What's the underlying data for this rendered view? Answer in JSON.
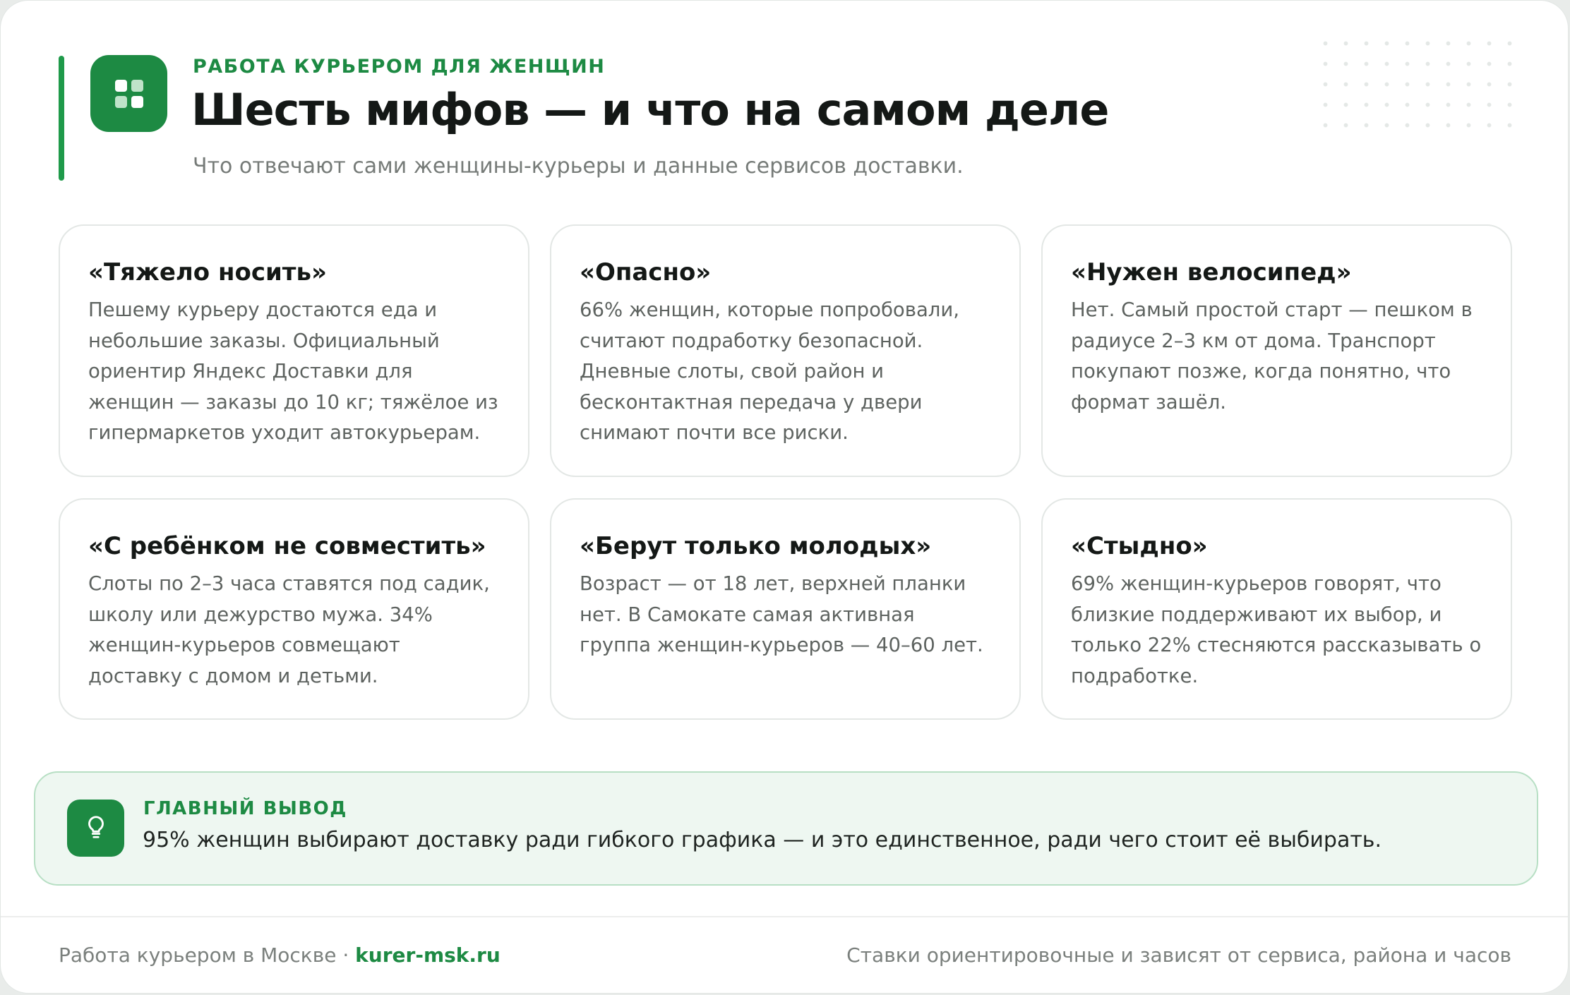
{
  "header": {
    "eyebrow": "РАБОТА КУРЬЕРОМ ДЛЯ ЖЕНЩИН",
    "title": "Шесть мифов — и что на самом деле",
    "subtitle": "Что отвечают сами женщины-курьеры и данные сервисов доставки.",
    "logo_icon": "grid-icon"
  },
  "cards": [
    {
      "title": "«Тяжело носить»",
      "text": "Пешему курьеру достаются еда и небольшие заказы. Официальный ориентир Яндекс Доставки для женщин — заказы до 10 кг; тяжёлое из гипермаркетов уходит автокурьерам."
    },
    {
      "title": "«Опасно»",
      "text": "66% женщин, которые попробовали, считают подработку безопасной. Дневные слоты, свой район и бесконтактная передача у двери снимают почти все риски."
    },
    {
      "title": "«Нужен велосипед»",
      "text": "Нет. Самый простой старт — пешком в радиусе 2–3 км от дома. Транспорт покупают позже, когда понятно, что формат зашёл."
    },
    {
      "title": "«С ребёнком не совместить»",
      "text": "Слоты по 2–3 часа ставятся под садик, школу или дежурство мужа. 34% женщин-курьеров совмещают доставку с домом и детьми."
    },
    {
      "title": "«Берут только молодых»",
      "text": "Возраст — от 18 лет, верхней планки нет. В Самокате самая активная группа женщин-курьеров — 40–60 лет."
    },
    {
      "title": "«Стыдно»",
      "text": "69% женщин-курьеров говорят, что близкие поддерживают их выбор, и только 22% стесняются рассказывать о подработке."
    }
  ],
  "conclusion": {
    "label": "ГЛАВНЫЙ ВЫВОД",
    "text": "95% женщин выбирают доставку ради гибкого графика — и это единственное, ради чего стоит её выбирать.",
    "icon": "lightbulb-icon"
  },
  "footer": {
    "left_text": "Работа курьером в Москве ·",
    "site": "kurer-msk.ru",
    "right_text": "Ставки ориентировочные и зависят от сервиса, района и часов"
  },
  "colors": {
    "accent": "#1d8a43",
    "accent_light": "#eef7f1",
    "title": "#141816",
    "muted": "#767b78"
  }
}
